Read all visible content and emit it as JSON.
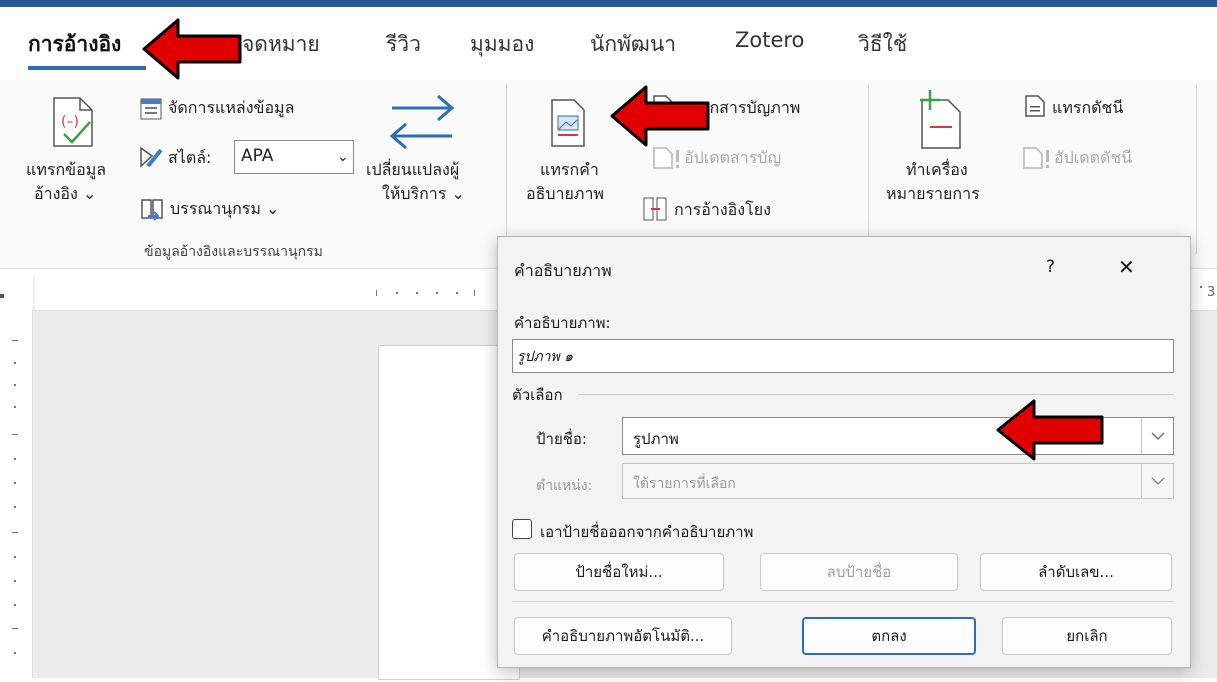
{
  "tabs": [
    {
      "label": "การอ้างอิง",
      "active": true
    },
    {
      "label": "จดหมาย"
    },
    {
      "label": "รีวิว"
    },
    {
      "label": "มุมมอง"
    },
    {
      "label": "นักพัฒนา"
    },
    {
      "label": "Zotero"
    },
    {
      "label": "วิธีใช้"
    }
  ],
  "ribbon": {
    "insert_citation": {
      "line1": "แทรกข้อมูล",
      "line2": "อ้างอิง ⌄"
    },
    "manage_sources": "จัดการแหล่งข้อมูล",
    "style_label": "สไตล์:",
    "style_value": "APA",
    "bibliography": "บรรณานุกรม ⌄",
    "switch_provider": {
      "line1": "เปลี่ยนแปลงผู้",
      "line2": "ให้บริการ ⌄"
    },
    "group_label": "ข้อมูลอ้างอิงและบรรณานุกรม",
    "insert_caption": {
      "line1": "แทรกคำ",
      "line2": "อธิบายภาพ"
    },
    "insert_table_of_figures": "แทรกสารบัญภาพ",
    "update_table": "อัปเดตสารบัญ",
    "cross_reference": "การอ้างอิงโยง",
    "mark_entry": {
      "line1": "ทำเครื่อง",
      "line2": "หมายรายการ"
    },
    "insert_index": "แทรกดัชนี",
    "update_index": "อัปเดตดัชนี"
  },
  "dialog": {
    "title": "คำอธิบายภาพ",
    "help": "?",
    "close": "✕",
    "caption_label": "คำอธิบายภาพ:",
    "caption_value": "รูปภาพ ๑",
    "options_label": "ตัวเลือก",
    "label_label": "ป้ายชื่อ:",
    "label_value": "รูปภาพ",
    "position_label": "ตำแหน่ง:",
    "position_value": "ใต้รายการที่เลือก",
    "exclude_label_text": "เอาป้ายชื่อออกจากคำอธิบายภาพ",
    "exclude_checked": false,
    "new_label_button": "ป้ายชื่อใหม่...",
    "delete_label_button": "ลบป้ายชื่อ",
    "numbering_button": "ลำดับเลข...",
    "autocaption_button": "คำอธิบายภาพอัตโนมัติ...",
    "ok_button": "ตกลง",
    "cancel_button": "ยกเลิก"
  },
  "colors": {
    "accent": "#2f6eb5",
    "annotation_arrow": "#e00000",
    "annotation_outline": "#000000"
  }
}
